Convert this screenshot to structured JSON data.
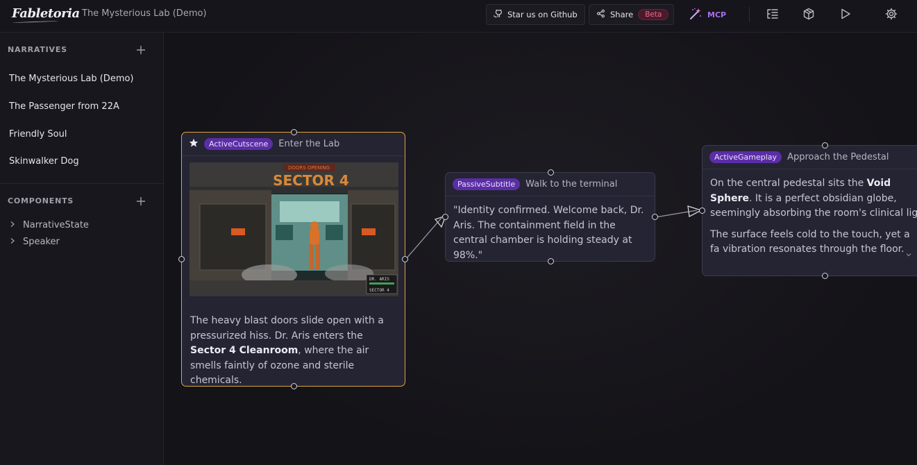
{
  "app": {
    "logo": "Fabletoria",
    "title": "The Mysterious Lab (Demo)"
  },
  "header": {
    "github_label": "Star us on Github",
    "share_label": "Share",
    "beta_label": "Beta",
    "mcp_label": "MCP"
  },
  "sidebar": {
    "narratives_heading": "NARRATIVES",
    "narratives": [
      {
        "label": "The Mysterious Lab (Demo)"
      },
      {
        "label": "The Passenger from 22A"
      },
      {
        "label": "Friendly Soul"
      },
      {
        "label": "Skinwalker Dog"
      }
    ],
    "components_heading": "COMPONENTS",
    "components": [
      {
        "label": "NarrativeState"
      },
      {
        "label": "Speaker"
      }
    ]
  },
  "nodes": {
    "enter_lab": {
      "badge": "ActiveCutscene",
      "title": "Enter the Lab",
      "image_sign": "DOORS OPENING",
      "image_sector": "SECTOR 4",
      "image_tag_1": "DR. ARIS",
      "image_tag_2": "SECTOR 4",
      "text_1": "The heavy blast doors slide open with a pressurized hiss. Dr. Aris enters the ",
      "text_bold": "Sector 4 Cleanroom",
      "text_2": ", where the air smells faintly of ozone and sterile chemicals."
    },
    "walk_terminal": {
      "badge": "PassiveSubtitle",
      "title": "Walk to the terminal",
      "text": "\"Identity confirmed. Welcome back, Dr. Aris. The containment field in the central chamber is holding steady at 98%.\""
    },
    "approach_pedestal": {
      "badge": "ActiveGameplay",
      "title": "Approach the Pedestal",
      "text_1": "On the central pedestal sits the ",
      "text_bold": "Void Sphere",
      "text_2": ". It is a perfect obsidian globe, seemingly absorbing the room's clinical ligh",
      "text_3": "The surface feels cold to the touch, yet a fa vibration resonates through the floor."
    }
  }
}
